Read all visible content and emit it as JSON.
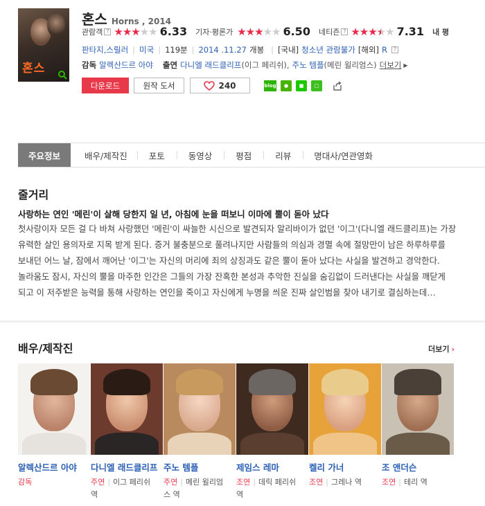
{
  "movie": {
    "title_kr": "혼스",
    "title_en": "Horns , 2014",
    "poster_title": "혼스"
  },
  "ratings": [
    {
      "label": "관람객",
      "q": "?",
      "stars_on": 3,
      "stars_half": 0,
      "score": "6.33"
    },
    {
      "label": "기자·평론가",
      "q": "",
      "stars_on": 3,
      "stars_half": 0,
      "score": "6.50"
    },
    {
      "label": "네티즌",
      "q": "?",
      "stars_on": 3,
      "stars_half": 1,
      "score": "7.31"
    }
  ],
  "rating_tail": "내 평",
  "info": {
    "genre1": "판타지",
    "genre2": "스릴러",
    "country": "미국",
    "runtime": "119분",
    "release_date": "2014 .11.27",
    "release_suffix": "개봉",
    "domestic_label": "[국내]",
    "domestic_rating": "청소년 관람불가",
    "overseas_label": "[해외]",
    "overseas_rating": "R",
    "director_label": "감독",
    "director": "알렉산드르 아야",
    "cast_label": "출연",
    "cast_1": "다니엘 래드클리프",
    "cast_1_role": "(이그 페리쉬),",
    "cast_2": "주노 템플",
    "cast_2_role": "(메린 윌리엄스)",
    "more_link": "더보기"
  },
  "actions": {
    "download": "다운로드",
    "book": "원작 도서",
    "likes": "240",
    "share_blog": "blog"
  },
  "tabs": [
    "주요정보",
    "배우/제작진",
    "포토",
    "동영상",
    "평점",
    "리뷰",
    "명대사/연관영화"
  ],
  "synopsis": {
    "title": "줄거리",
    "headline": "사랑하는 연인 '메린'이 살해 당한지 일 년, 아침에 눈을 떠보니 이마에 뿔이 돋아 났다",
    "body": "첫사랑이자 모든 걸 다 바쳐 사랑했던 '메린'이 싸늘한 시신으로 발견되자 알리바이가 없던 '이그'(다니엘 래드클리프)는 가장 유력한 살인 용의자로 지목 받게 된다. 증거 불충분으로 풀려나지만 사람들의 의심과 경멸 속에 절망만이 남은 하루하루를 보내던 어느 날, 잠에서 깨어난 '이그'는 자신의 머리에 죄의 상징과도 같은 뿔이 돋아 났다는 사실을 발견하고 경악한다. 놀라움도 잠시, 자신의 뿔을 마주한 인간은 그들의 가장 잔혹한 본성과 추악한 진실을 숨김없이 드러낸다는 사실을 깨닫게 되고 이 저주받은 능력을 통해 사랑하는 연인을 죽이고 자신에게 누명을 씌운 진짜 살인범을 찾아 내기로 결심하는데…"
  },
  "cast_section": {
    "title": "배우/제작진",
    "more": "더보기",
    "people": [
      {
        "name": "알렉산드르 아야",
        "role": "감독",
        "character": ""
      },
      {
        "name": "다니엘 래드클리프",
        "role": "주연",
        "character": "이그 페리쉬 역"
      },
      {
        "name": "주노 템플",
        "role": "주연",
        "character": "메린 윌리엄스 역"
      },
      {
        "name": "제임스 레마",
        "role": "조연",
        "character": "데릭 페리쉬 역"
      },
      {
        "name": "켈리 가너",
        "role": "조연",
        "character": "그레나 역"
      },
      {
        "name": "조 앤더슨",
        "role": "조연",
        "character": "테리 역"
      }
    ]
  },
  "colors": {
    "accent_red": "#e8394a",
    "link_blue": "#2b5fb4",
    "active_tab": "#7a7a7a"
  }
}
